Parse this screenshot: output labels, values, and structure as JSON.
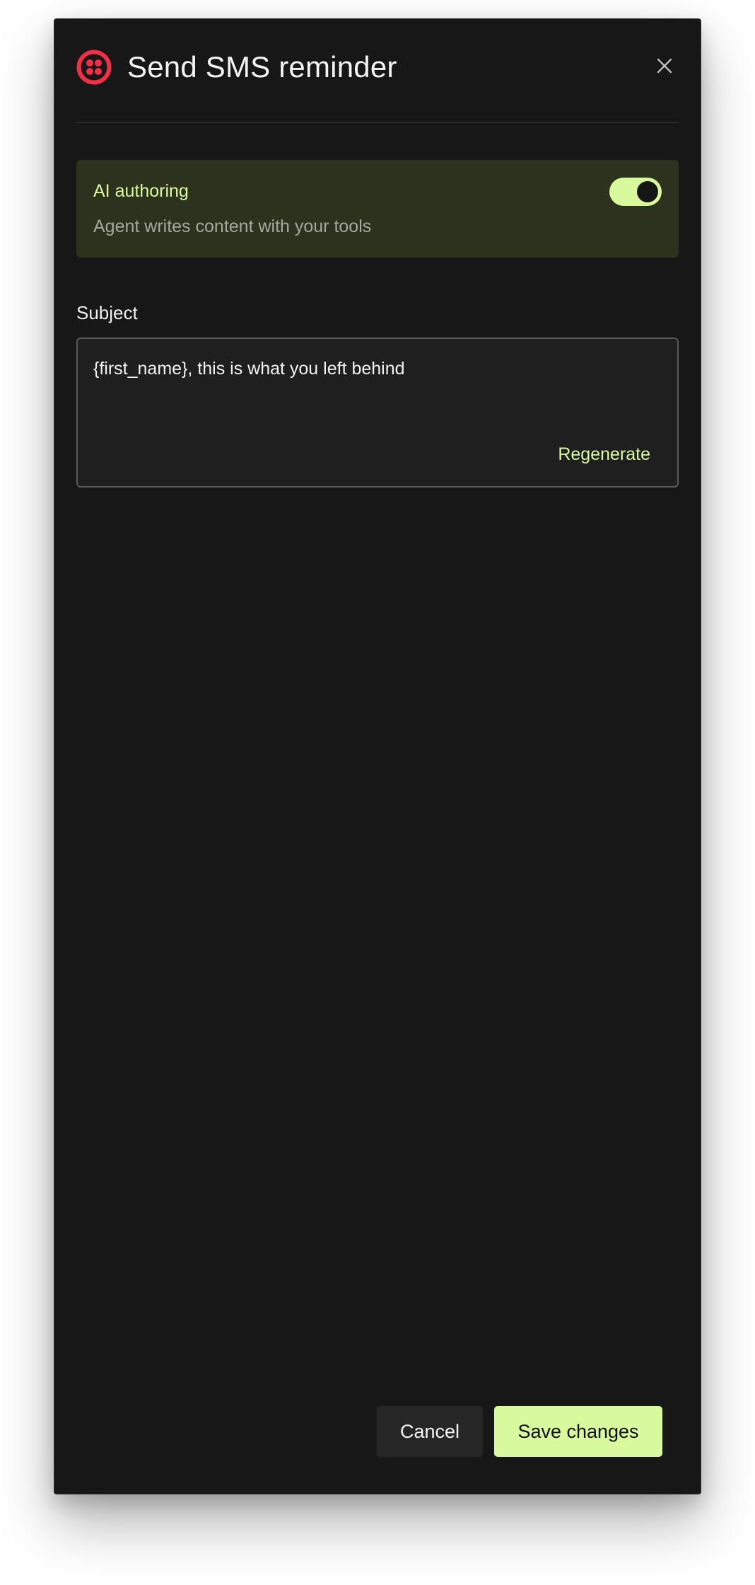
{
  "dialog": {
    "title": "Send SMS reminder",
    "brand_icon": "twilio-logo-icon",
    "close_icon": "close-icon"
  },
  "ai_authoring": {
    "title": "AI authoring",
    "description": "Agent writes content with your tools",
    "enabled": true
  },
  "subject": {
    "label": "Subject",
    "value": "{first_name}, this is what you left behind",
    "regenerate_label": "Regenerate"
  },
  "footer": {
    "cancel_label": "Cancel",
    "save_label": "Save changes"
  },
  "colors": {
    "accent": "#d9f99d",
    "brand": "#f22f46",
    "background": "#171717",
    "card": "#2c321e"
  }
}
